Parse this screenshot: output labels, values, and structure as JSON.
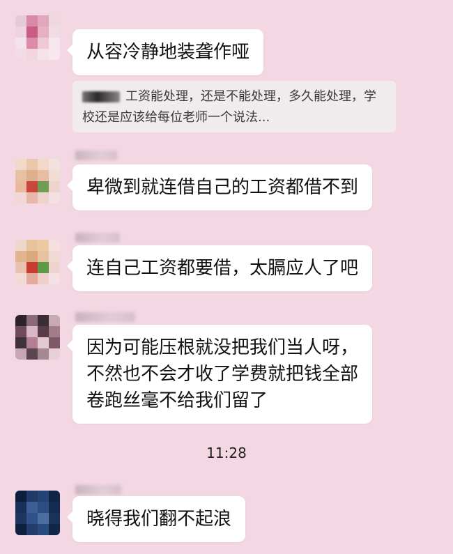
{
  "messages": [
    {
      "text": "从容冷静地装聋作哑"
    },
    {
      "quote": "工资能处理，还是不能处理，多久能处理，学校还是应该给每位老师一个说法..."
    },
    {
      "text": "卑微到就连借自己的工资都借不到"
    },
    {
      "text": "连自己工资都要借，太膈应人了吧"
    },
    {
      "text": "因为可能压根就没把我们当人呀，\n不然也不会才收了学费就把钱全部\n卷跑丝毫不给我们留了"
    },
    {
      "text": "晓得我们翻不起浪"
    }
  ],
  "timestamp": "11:28",
  "colors": {
    "background": "#f3d7e2",
    "bubble": "#ffffff",
    "quote_bg": "#f0ebed"
  }
}
